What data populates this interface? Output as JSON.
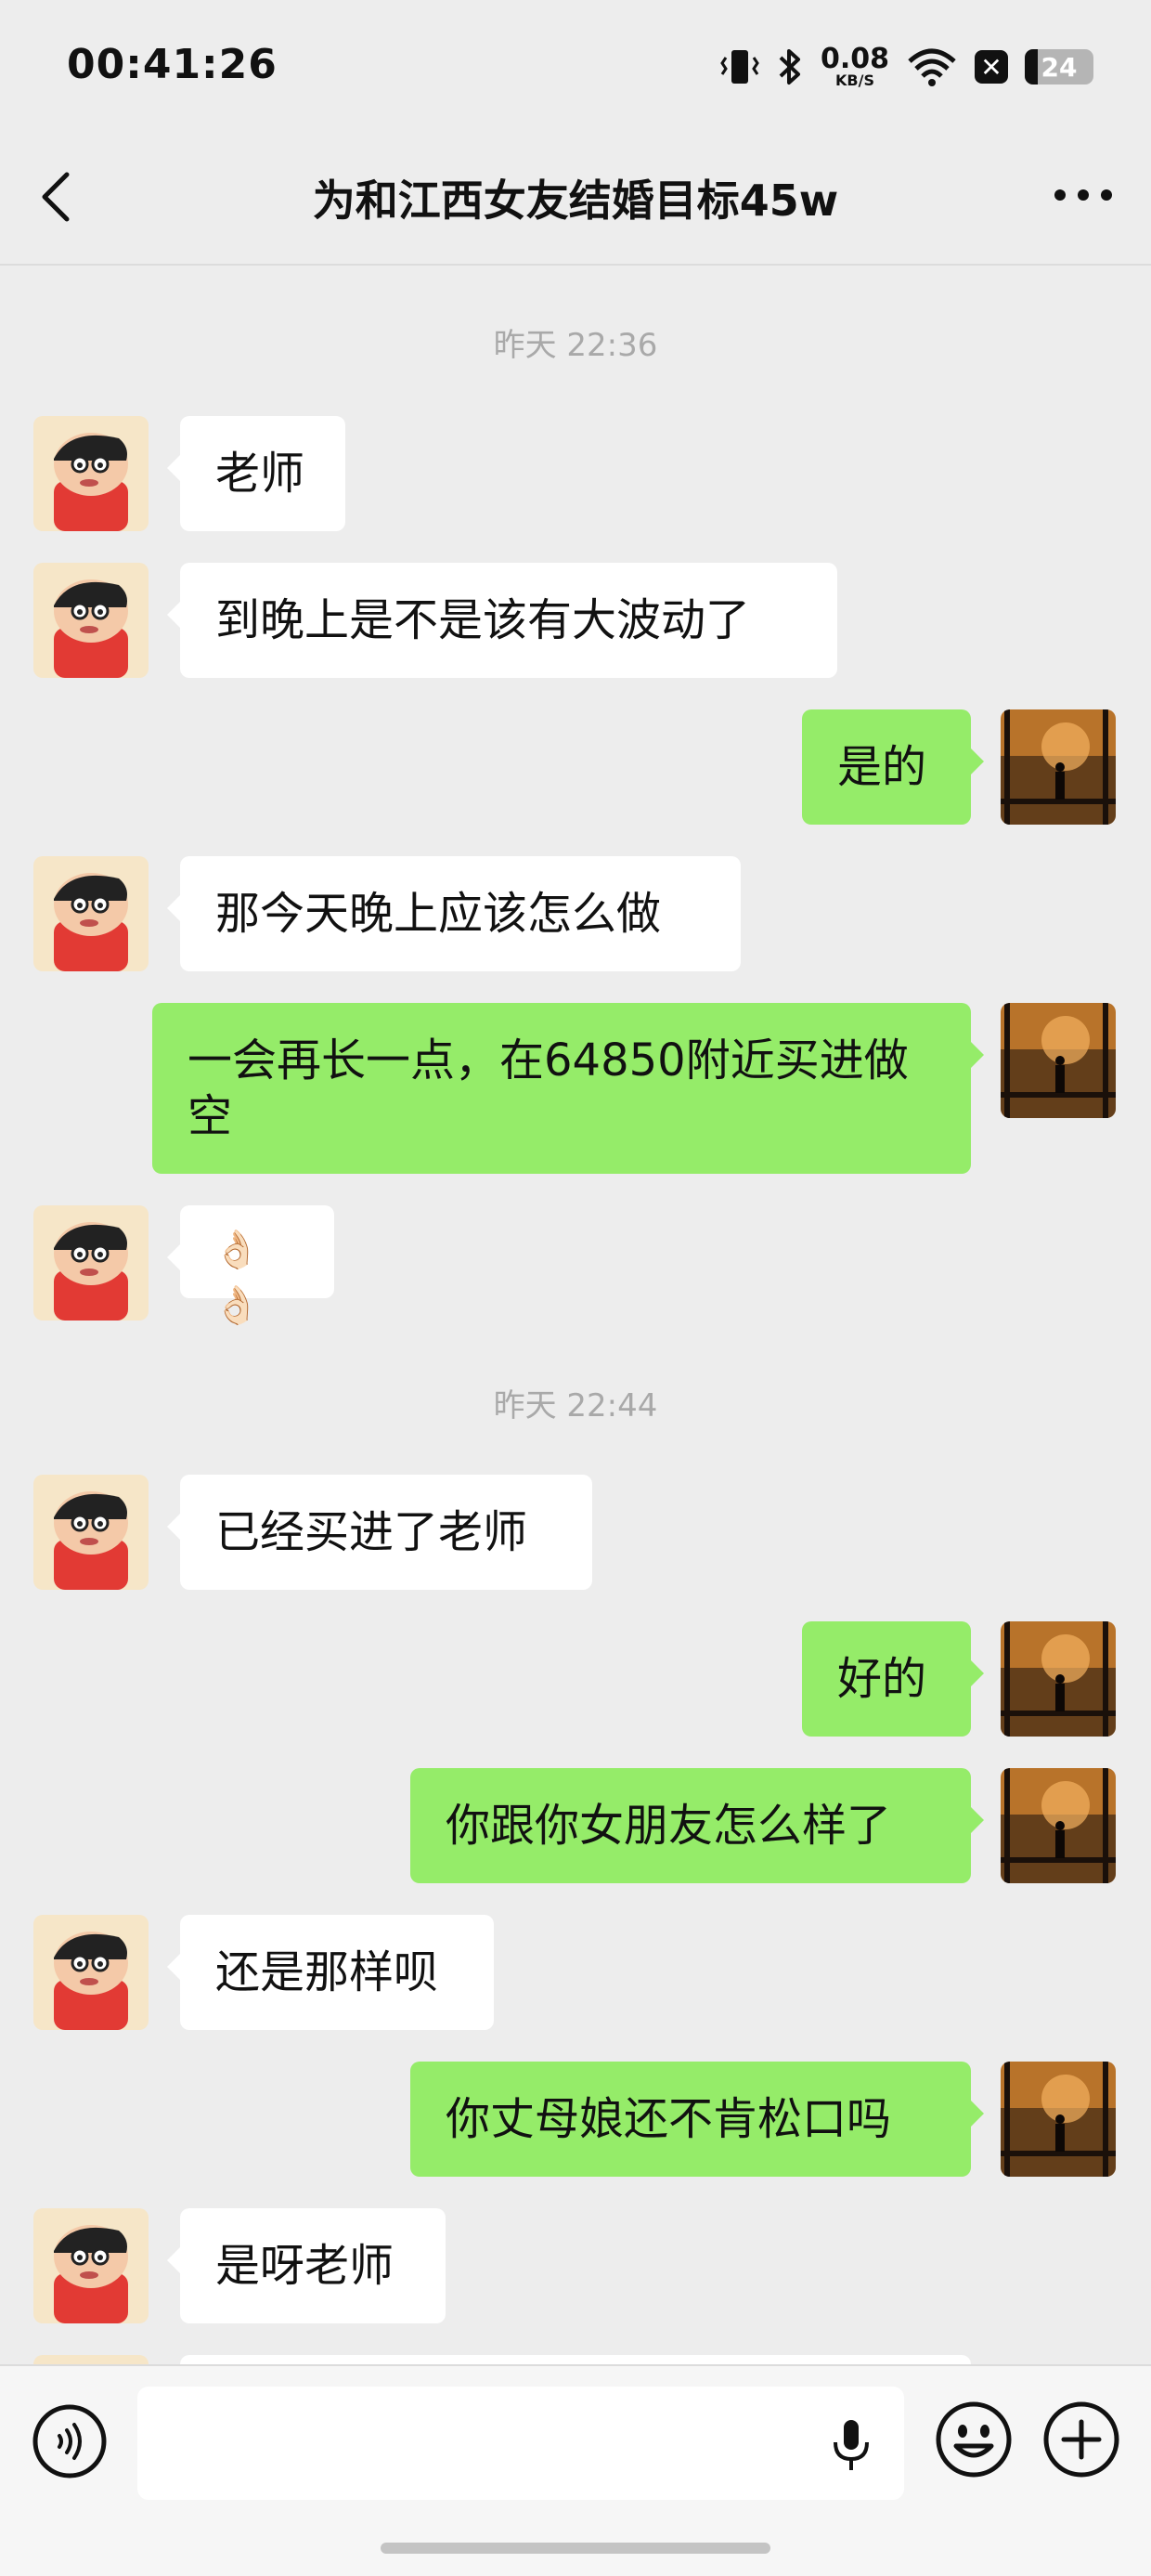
{
  "status_bar": {
    "time": "00:41:26",
    "net_speed": "0.08",
    "net_unit": "KB/S",
    "battery": "24"
  },
  "nav": {
    "title": "为和江西女友结婚目标45w",
    "back_icon": "chevron-left-icon",
    "more_icon": "more-icon"
  },
  "timestamps": [
    "昨天 22:36",
    "昨天 22:44"
  ],
  "messages": [
    {
      "side": "in",
      "text": "老师"
    },
    {
      "side": "in",
      "text": "到晚上是不是该有大波动了"
    },
    {
      "side": "out",
      "text": "是的"
    },
    {
      "side": "in",
      "text": "那今天晚上应该怎么做"
    },
    {
      "side": "out",
      "text": "一会再长一点，在64850附近买进做空"
    },
    {
      "side": "in",
      "text": "👌🏻👌🏻"
    },
    {
      "side": "in",
      "text": "已经买进了老师"
    },
    {
      "side": "out",
      "text": "好的"
    },
    {
      "side": "out",
      "text": "你跟你女朋友怎么样了"
    },
    {
      "side": "in",
      "text": "还是那样呗"
    },
    {
      "side": "out",
      "text": "你丈母娘还不肯松口吗"
    },
    {
      "side": "in",
      "text": "是呀老师"
    }
  ],
  "input_bar": {
    "icons": [
      "voice-icon",
      "microphone-icon",
      "emoji-icon",
      "plus-icon"
    ]
  },
  "colors": {
    "background": "#ededed",
    "outgoing_bubble": "#95ec69",
    "incoming_bubble": "#ffffff"
  }
}
